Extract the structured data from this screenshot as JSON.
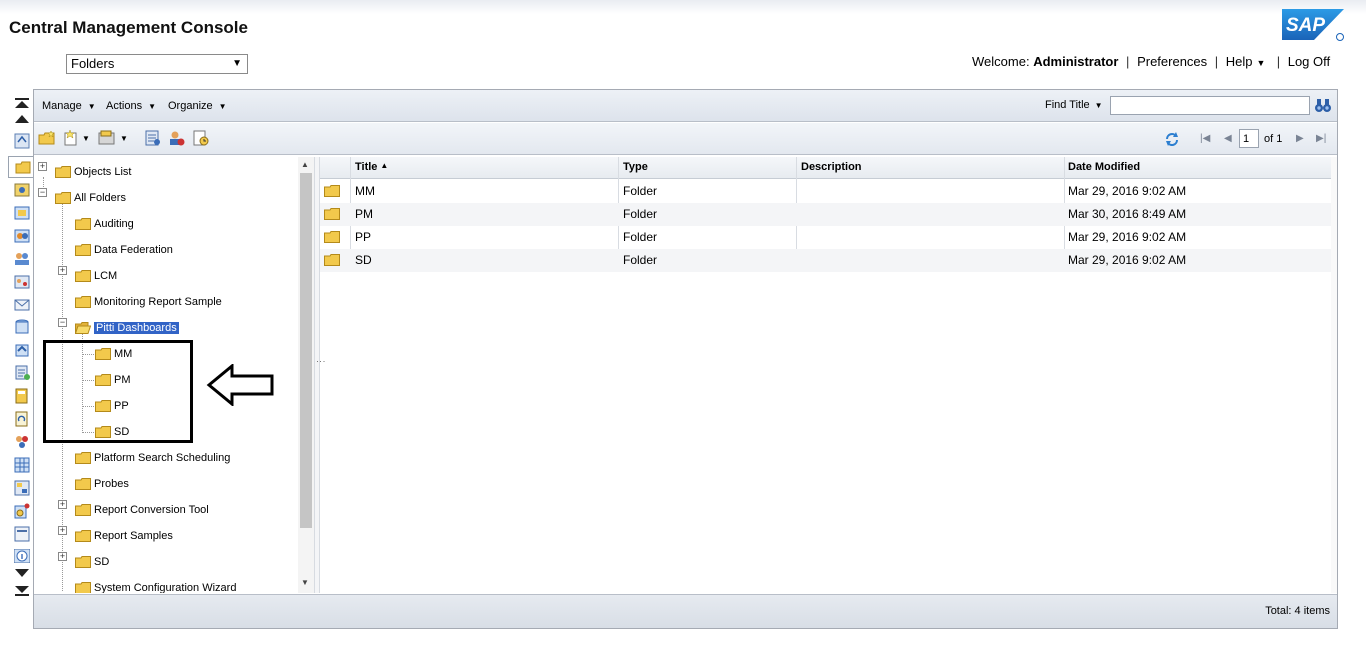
{
  "app_title": "Central Management Console",
  "area_select": {
    "value": "Folders"
  },
  "user_bar": {
    "welcome_label": "Welcome:",
    "user": "Administrator",
    "preferences": "Preferences",
    "help": "Help",
    "logoff": "Log Off"
  },
  "menus": {
    "manage": "Manage",
    "actions": "Actions",
    "organize": "Organize"
  },
  "find": {
    "label": "Find Title",
    "value": ""
  },
  "pager": {
    "current": "1",
    "of": "of 1"
  },
  "tree": {
    "objects_list": "Objects List",
    "all_folders": "All Folders",
    "items": [
      "Auditing",
      "Data Federation",
      "LCM",
      "Monitoring Report Sample",
      "Pitti Dashboards",
      "MM",
      "PM",
      "PP",
      "SD",
      "Platform Search Scheduling",
      "Probes",
      "Report Conversion Tool",
      "Report Samples",
      "SD",
      "System Configuration Wizard"
    ]
  },
  "grid": {
    "columns": [
      "Title",
      "Type",
      "Description",
      "Date Modified"
    ],
    "rows": [
      {
        "title": "MM",
        "type": "Folder",
        "description": "",
        "date": "Mar 29, 2016 9:02 AM"
      },
      {
        "title": "PM",
        "type": "Folder",
        "description": "",
        "date": "Mar 30, 2016 8:49 AM"
      },
      {
        "title": "PP",
        "type": "Folder",
        "description": "",
        "date": "Mar 29, 2016 9:02 AM"
      },
      {
        "title": "SD",
        "type": "Folder",
        "description": "",
        "date": "Mar 29, 2016 9:02 AM"
      }
    ]
  },
  "status": {
    "total": "Total: 4 items"
  },
  "colors": {
    "selection": "#3163c6",
    "folder": "#f2c94c",
    "sap_blue": "#1f6fc5"
  }
}
